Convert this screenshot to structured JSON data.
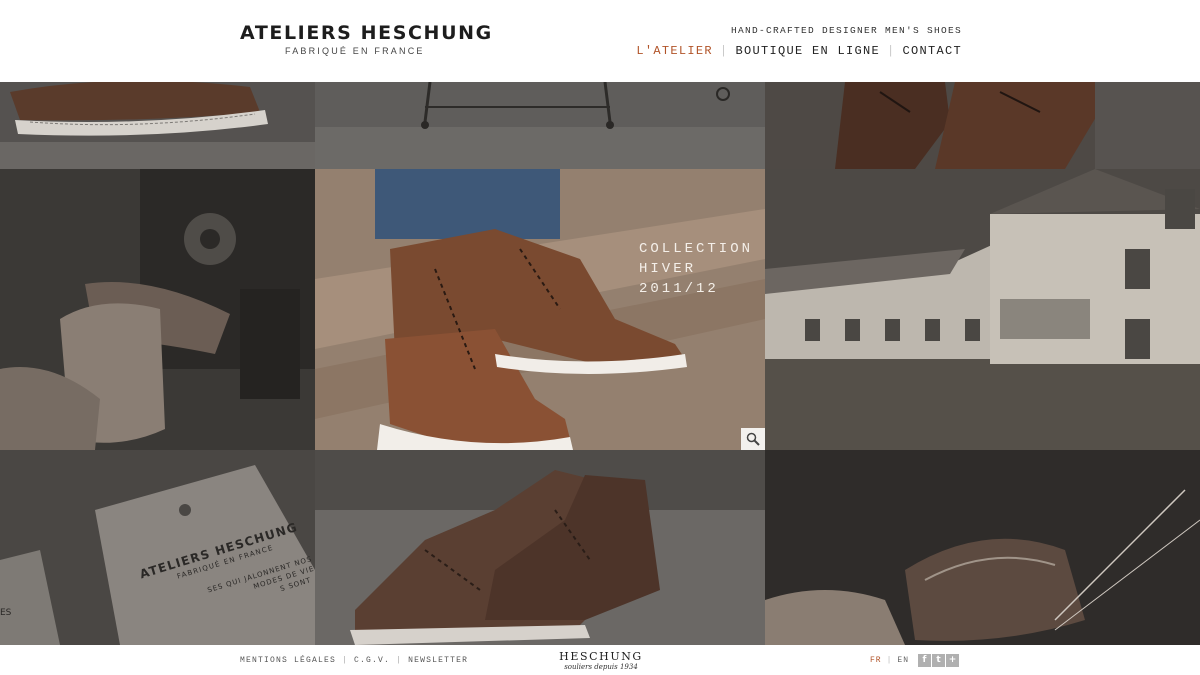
{
  "header": {
    "brand_title": "ATELIERS HESCHUNG",
    "brand_subtitle": "FABRIQUÉ EN FRANCE",
    "tagline": "HAND-CRAFTED DESIGNER MEN'S SHOES",
    "nav": [
      {
        "label": "L'ATELIER",
        "active": true
      },
      {
        "label": "BOUTIQUE EN LIGNE",
        "active": false
      },
      {
        "label": "CONTACT",
        "active": false
      }
    ],
    "accent_color": "#b15328"
  },
  "featured": {
    "line1": "COLLECTION",
    "line2": "HIVER",
    "line3": "2011/12"
  },
  "tag_card": {
    "title": "ATELIERS HESCHUNG",
    "subtitle": "FABRIQUÉ EN FRANCE",
    "text1": "SES QUI JALONNENT NOS",
    "text2": "MODES DE VIE",
    "text3": "S SONT",
    "side": "ES"
  },
  "footer": {
    "links": [
      "MENTIONS LÉGALES",
      "C.G.V.",
      "NEWSLETTER"
    ],
    "logo_name": "HESCHUNG",
    "logo_since": "souliers depuis 1934",
    "lang_fr": "FR",
    "lang_en": "EN",
    "social": [
      {
        "icon": "facebook-icon",
        "glyph": "f"
      },
      {
        "icon": "twitter-icon",
        "glyph": "t"
      },
      {
        "icon": "plus-icon",
        "glyph": "+"
      }
    ]
  }
}
